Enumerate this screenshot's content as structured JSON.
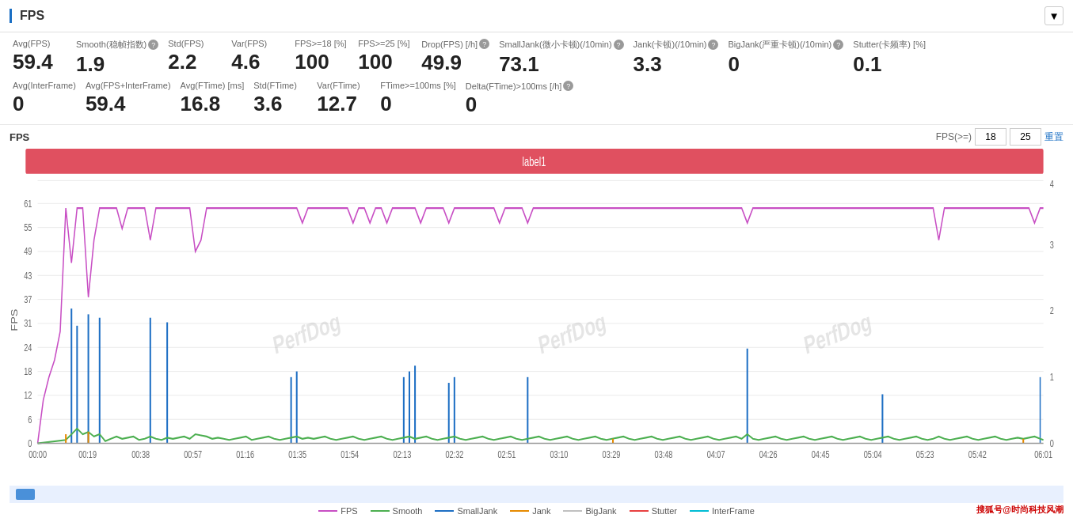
{
  "header": {
    "title": "FPS",
    "dropdown_label": "▼"
  },
  "stats_row1": [
    {
      "label": "Avg(FPS)",
      "value": "59.4",
      "has_help": false
    },
    {
      "label": "Smooth(稳帧指数)",
      "value": "1.9",
      "has_help": true
    },
    {
      "label": "Std(FPS)",
      "value": "2.2",
      "has_help": false
    },
    {
      "label": "Var(FPS)",
      "value": "4.6",
      "has_help": false
    },
    {
      "label": "FPS>=18 [%]",
      "value": "100",
      "has_help": false
    },
    {
      "label": "FPS>=25 [%]",
      "value": "100",
      "has_help": false
    },
    {
      "label": "Drop(FPS) [/h]",
      "value": "49.9",
      "has_help": true
    },
    {
      "label": "SmallJank(微小卡顿)(/10min)",
      "value": "73.1",
      "has_help": true
    },
    {
      "label": "Jank(卡顿)(/10min)",
      "value": "3.3",
      "has_help": true
    },
    {
      "label": "BigJank(严重卡顿)(/10min)",
      "value": "0",
      "has_help": true
    },
    {
      "label": "Stutter(卡频率) [%]",
      "value": "0.1",
      "has_help": false
    }
  ],
  "stats_row2": [
    {
      "label": "Avg(InterFrame)",
      "value": "0",
      "has_help": false
    },
    {
      "label": "Avg(FPS+InterFrame)",
      "value": "59.4",
      "has_help": false
    },
    {
      "label": "Avg(FTime) [ms]",
      "value": "16.8",
      "has_help": false
    },
    {
      "label": "Std(FTime)",
      "value": "3.6",
      "has_help": false
    },
    {
      "label": "Var(FTime)",
      "value": "12.7",
      "has_help": false
    },
    {
      "label": "FTime>=100ms [%]",
      "value": "0",
      "has_help": false
    },
    {
      "label": "Delta(FTime)>100ms [/h]",
      "value": "0",
      "has_help": true
    }
  ],
  "chart": {
    "title": "FPS",
    "fps_label": "FPS(>=)",
    "fps_value1": "18",
    "fps_value2": "25",
    "reset_label": "重置",
    "label_bar": "label1",
    "x_ticks": [
      "00:00",
      "00:19",
      "00:38",
      "00:57",
      "01:16",
      "01:35",
      "01:54",
      "02:13",
      "02:32",
      "02:51",
      "03:10",
      "03:29",
      "03:48",
      "04:07",
      "04:26",
      "04:45",
      "05:04",
      "05:23",
      "05:42",
      "06:01"
    ],
    "y_ticks_fps": [
      "0",
      "6",
      "12",
      "18",
      "24",
      "31",
      "37",
      "43",
      "49",
      "55",
      "61"
    ],
    "y_ticks_jank": [
      "0",
      "1",
      "2",
      "3",
      "4"
    ]
  },
  "legend": [
    {
      "name": "FPS",
      "color": "#c84fc4",
      "type": "line"
    },
    {
      "name": "Smooth",
      "color": "#4caf50",
      "type": "line"
    },
    {
      "name": "SmallJank",
      "color": "#1e6fc4",
      "type": "line"
    },
    {
      "name": "Jank",
      "color": "#e68a00",
      "type": "line"
    },
    {
      "name": "BigJank",
      "color": "#c0c0c0",
      "type": "line"
    },
    {
      "name": "Stutter",
      "color": "#e84040",
      "type": "line"
    },
    {
      "name": "InterFrame",
      "color": "#00bcd4",
      "type": "line"
    }
  ],
  "watermarks": [
    "PerfDog",
    "PerfDog",
    "PerfDog"
  ],
  "branding": "搜狐号@时尚科技风潮"
}
